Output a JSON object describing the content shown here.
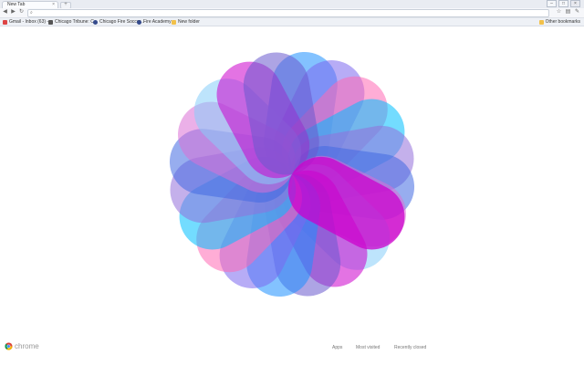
{
  "tab": {
    "title": "New Tab"
  },
  "bookmarks": [
    {
      "label": "Gmail - Inbox (63) -...",
      "icon": "gmail-icon"
    },
    {
      "label": "Chicago Tribune: C...",
      "icon": "tribune-icon"
    },
    {
      "label": "Chicago Fire Soccer...",
      "icon": "fire-icon"
    },
    {
      "label": "Fire Academy",
      "icon": "fire-icon"
    },
    {
      "label": "New folder",
      "icon": "folder-icon"
    }
  ],
  "other_bookmarks": "Other bookmarks",
  "footer": {
    "brand": "chrome",
    "links": [
      "Apps",
      "Most visited",
      "Recently closed"
    ]
  },
  "colors": {
    "petal_palette": [
      "#1e90ff",
      "#7b68ee",
      "#ff69b4",
      "#00bfff",
      "#9370db",
      "#4169e1",
      "#da70d6",
      "#87cefa",
      "#cc00cc",
      "#6a5acd"
    ],
    "highlight_petal": "#cc00cc"
  }
}
